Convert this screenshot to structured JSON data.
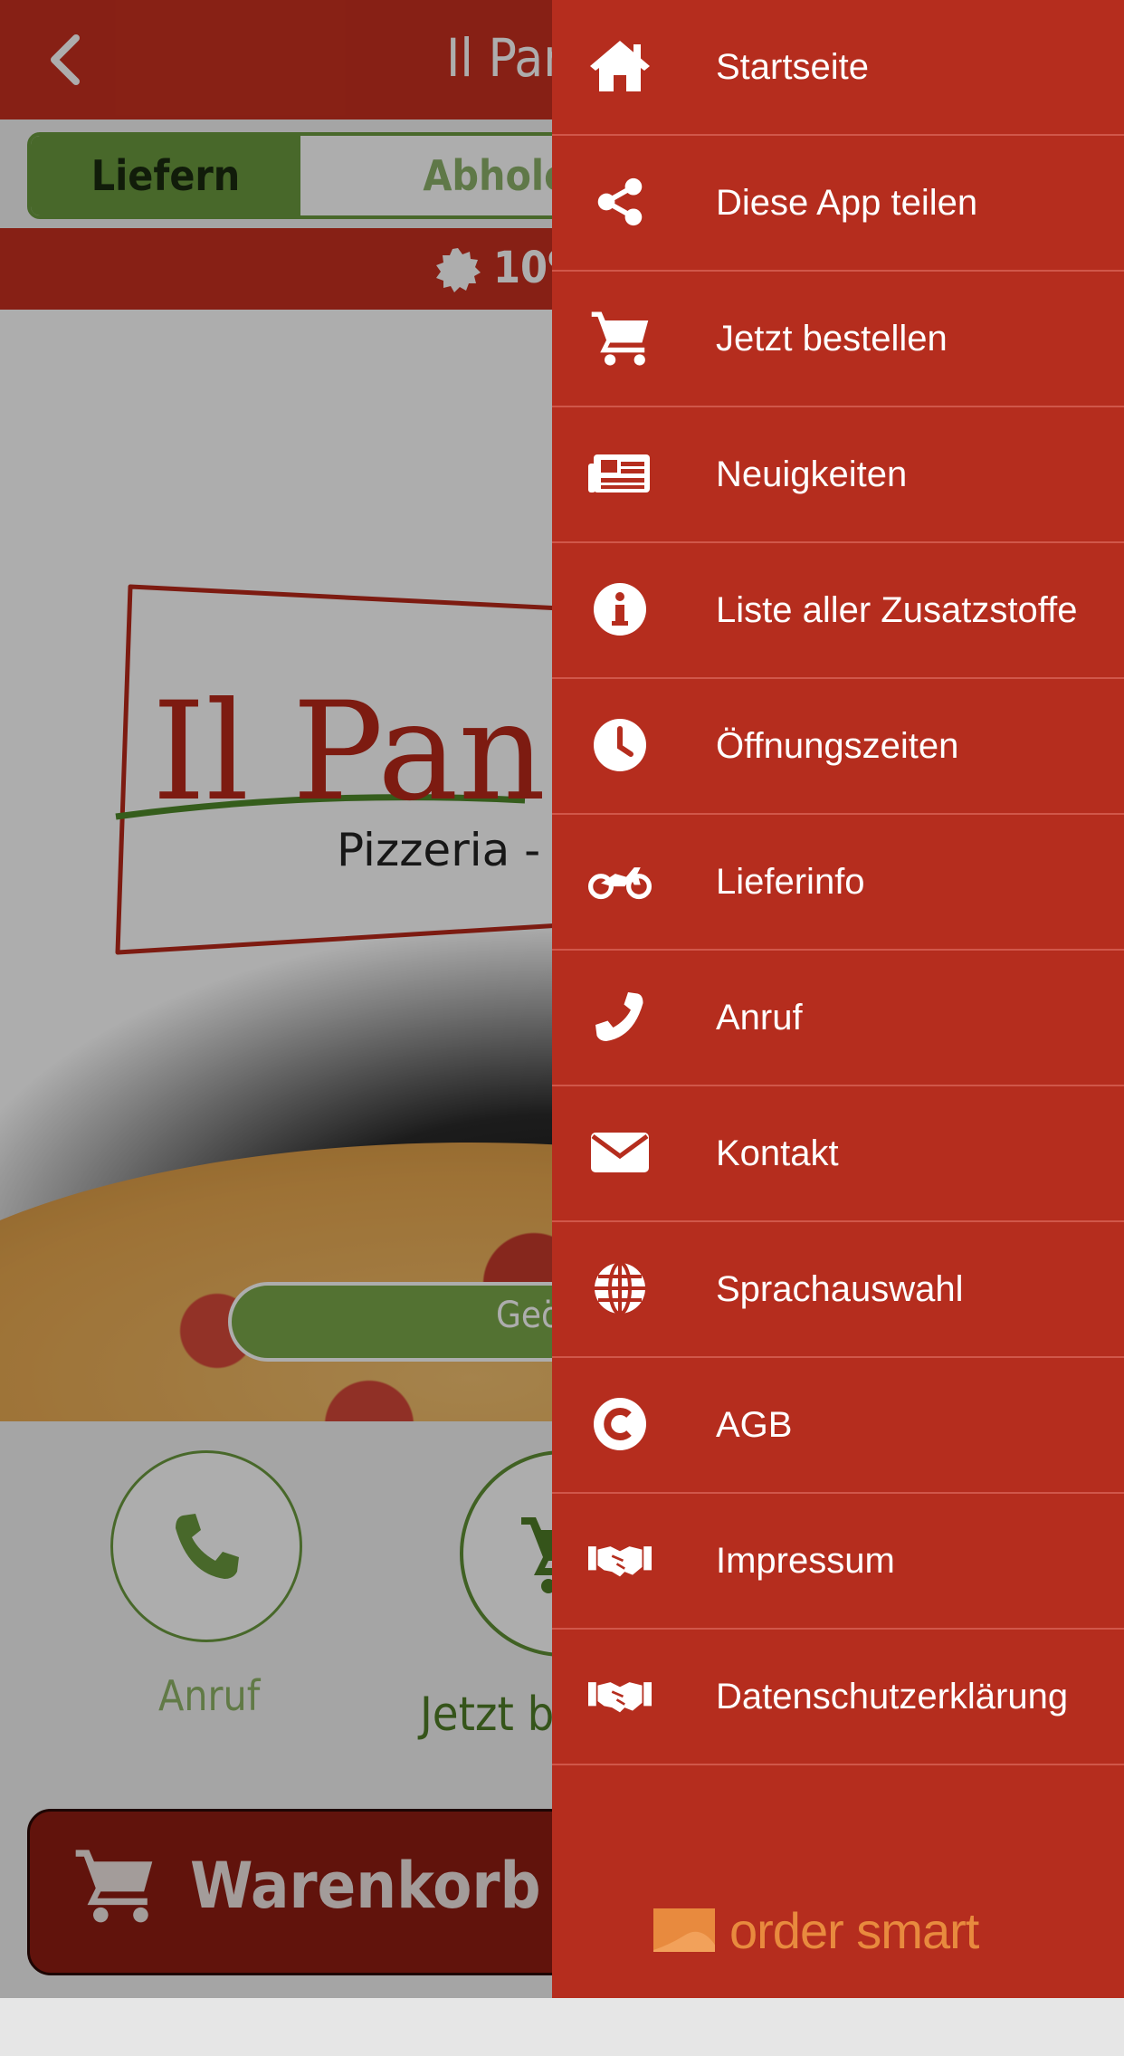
{
  "header": {
    "title": "Il Pan"
  },
  "order_tabs": {
    "active": "Liefern",
    "inactive": "Abholen"
  },
  "promo": {
    "text": "10%"
  },
  "hero": {
    "logo_title": "Il Pan",
    "logo_subtitle": "Pizzeria -",
    "geo_button": "Geö"
  },
  "quick_actions": {
    "call_label": "Anruf",
    "order_label": "Jetzt b"
  },
  "cart": {
    "label": "Warenkorb"
  },
  "colors": {
    "brand_red": "#c8301f",
    "drawer_red": "#b52d1e",
    "accent_green": "#6b9a3f",
    "cart_dark": "#8f1d12"
  },
  "drawer": {
    "items": [
      {
        "label": "Startseite",
        "icon": "home-icon"
      },
      {
        "label": "Diese App teilen",
        "icon": "share-icon"
      },
      {
        "label": "Jetzt bestellen",
        "icon": "cart-icon"
      },
      {
        "label": "Neuigkeiten",
        "icon": "newspaper-icon"
      },
      {
        "label": "Liste aller Zusatzstoffe",
        "icon": "info-icon"
      },
      {
        "label": "Öffnungszeiten",
        "icon": "clock-icon"
      },
      {
        "label": "Lieferinfo",
        "icon": "motorcycle-icon"
      },
      {
        "label": "Anruf",
        "icon": "phone-icon"
      },
      {
        "label": "Kontakt",
        "icon": "envelope-icon"
      },
      {
        "label": "Sprachauswahl",
        "icon": "globe-icon"
      },
      {
        "label": "AGB",
        "icon": "copyright-icon"
      },
      {
        "label": "Impressum",
        "icon": "handshake-icon"
      },
      {
        "label": "Datenschutzerklärung",
        "icon": "handshake-icon"
      }
    ],
    "brand": "order smart"
  }
}
